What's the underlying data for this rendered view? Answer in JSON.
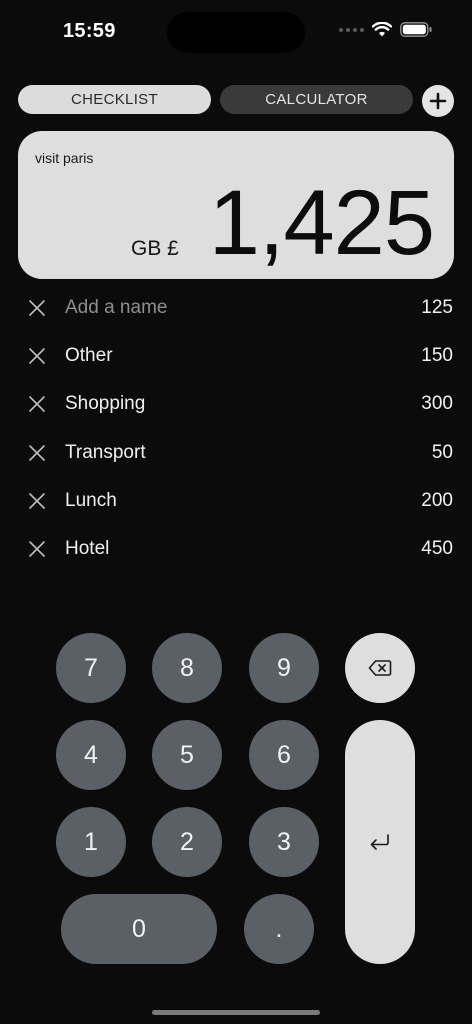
{
  "status_bar": {
    "time": "15:59",
    "icons": [
      "signal-dots-icon",
      "wifi-icon",
      "battery-icon"
    ]
  },
  "tabs": [
    {
      "label": "CHECKLIST",
      "active": false
    },
    {
      "label": "CALCULATOR",
      "active": true
    }
  ],
  "add_button_icon": "plus-icon",
  "summary": {
    "trip_name": "visit paris",
    "currency": "GB £",
    "total": "1,425"
  },
  "expenses": [
    {
      "name": "Add a name",
      "is_placeholder": true,
      "amount": "125"
    },
    {
      "name": "Other",
      "is_placeholder": false,
      "amount": "150"
    },
    {
      "name": "Shopping",
      "is_placeholder": false,
      "amount": "300"
    },
    {
      "name": "Transport",
      "is_placeholder": false,
      "amount": "50"
    },
    {
      "name": "Lunch",
      "is_placeholder": false,
      "amount": "200"
    },
    {
      "name": "Hotel",
      "is_placeholder": false,
      "amount": "450"
    }
  ],
  "keypad": {
    "digits": [
      "7",
      "8",
      "9",
      "4",
      "5",
      "6",
      "1",
      "2",
      "3",
      "0"
    ],
    "decimal": ".",
    "backspace_icon": "backspace-icon",
    "enter_icon": "return-icon"
  },
  "colors": {
    "background": "#0b0b0b",
    "card": "#dedede",
    "key": "#5a6066",
    "tab_inactive": "#3a3a3a"
  }
}
